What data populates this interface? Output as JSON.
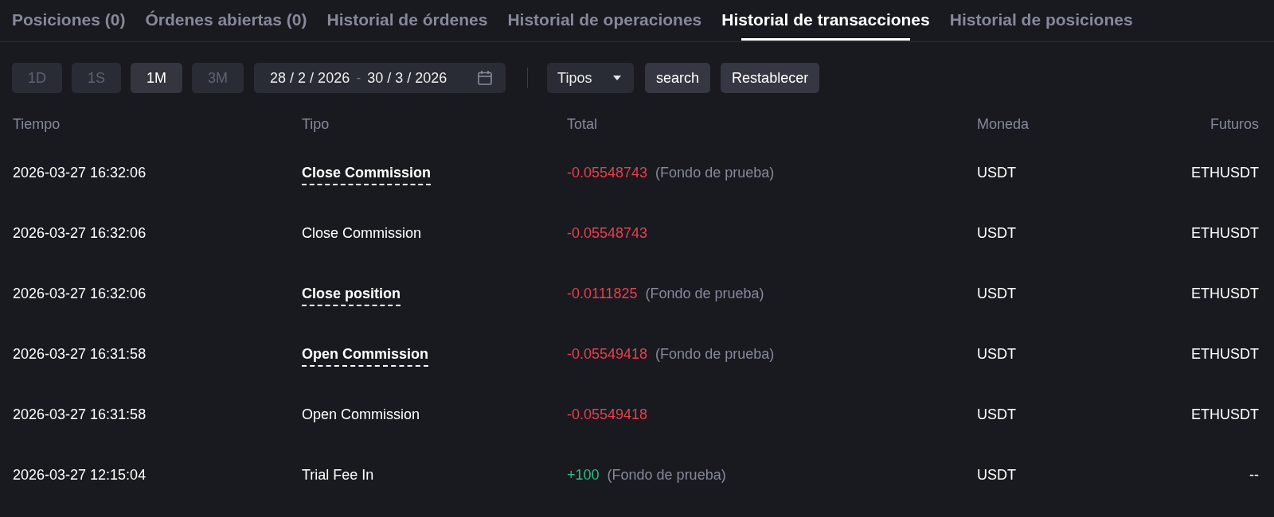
{
  "tabs": [
    {
      "label": "Posiciones (0)",
      "selected": false
    },
    {
      "label": "Órdenes abiertas (0)",
      "selected": false
    },
    {
      "label": "Historial de órdenes",
      "selected": false
    },
    {
      "label": "Historial de operaciones",
      "selected": false
    },
    {
      "label": "Historial de transacciones",
      "selected": true
    },
    {
      "label": "Historial de posiciones",
      "selected": false
    }
  ],
  "filters": {
    "ranges": [
      {
        "label": "1D",
        "selected": false
      },
      {
        "label": "1S",
        "selected": false
      },
      {
        "label": "1M",
        "selected": true
      },
      {
        "label": "3M",
        "selected": false
      }
    ],
    "date_range": {
      "start": "28 / 2 / 2026",
      "separator": "-",
      "end": "30 / 3 / 2026"
    },
    "type_select": {
      "value": "Tipos"
    },
    "buttons": [
      "search",
      "Restablecer"
    ]
  },
  "table": {
    "columns": [
      "Tiempo",
      "Tipo",
      "Total",
      "Moneda",
      "Futuros"
    ],
    "rows": [
      {
        "time": "2026-03-27 16:32:06",
        "type": "Close Commission",
        "hint": true,
        "amount": "-0.05548743",
        "positive": false,
        "note": "(Fondo de prueba)",
        "currency": "USDT",
        "futures": "ETHUSDT"
      },
      {
        "time": "2026-03-27 16:32:06",
        "type": "Close Commission",
        "hint": false,
        "amount": "-0.05548743",
        "positive": false,
        "currency": "USDT",
        "futures": "ETHUSDT"
      },
      {
        "time": "2026-03-27 16:32:06",
        "type": "Close position",
        "hint": true,
        "amount": "-0.0111825",
        "positive": false,
        "note": "(Fondo de prueba)",
        "currency": "USDT",
        "futures": "ETHUSDT"
      },
      {
        "time": "2026-03-27 16:31:58",
        "type": "Open Commission",
        "hint": true,
        "amount": "-0.05549418",
        "positive": false,
        "note": "(Fondo de prueba)",
        "currency": "USDT",
        "futures": "ETHUSDT"
      },
      {
        "time": "2026-03-27 16:31:58",
        "type": "Open Commission",
        "hint": false,
        "amount": "-0.05549418",
        "positive": false,
        "currency": "USDT",
        "futures": "ETHUSDT"
      },
      {
        "time": "2026-03-27 12:15:04",
        "type": "Trial Fee In",
        "hint": false,
        "amount": "+100",
        "positive": true,
        "note": "(Fondo de prueba)",
        "currency": "USDT",
        "futures": "--"
      }
    ]
  }
}
